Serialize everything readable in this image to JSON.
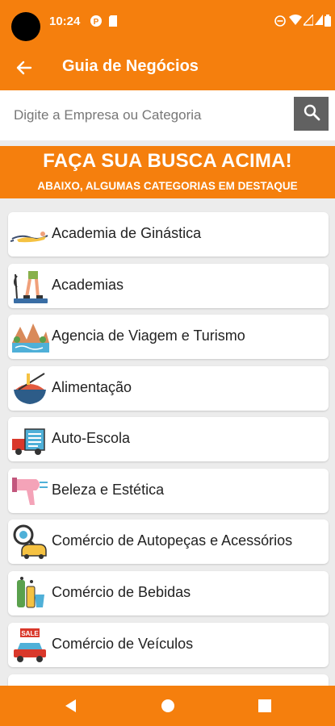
{
  "status_bar": {
    "time": "10:24",
    "icons": [
      "pinterest-icon",
      "sd-card-icon",
      "do-not-disturb-icon",
      "wifi-icon",
      "signal-icon",
      "signal-icon",
      "battery-icon"
    ]
  },
  "app_bar": {
    "back_icon": "arrow-left-icon",
    "title": "Guia de Negócios"
  },
  "search": {
    "placeholder": "Digite a Empresa ou Categoria",
    "value": "",
    "button_icon": "search-icon"
  },
  "banner": {
    "title": "FAÇA SUA BUSCA ACIMA!",
    "subtitle": "ABAIXO, ALGUMAS CATEGORIAS EM DESTAQUE"
  },
  "categories": [
    {
      "label": "Academia de Ginástica",
      "icon": "gymnast-icon"
    },
    {
      "label": "Academias",
      "icon": "exercise-machine-icon"
    },
    {
      "label": "Agencia de Viagem e Turismo",
      "icon": "landscape-icon"
    },
    {
      "label": "Alimentação",
      "icon": "food-bowl-icon"
    },
    {
      "label": "Auto-Escola",
      "icon": "driving-school-truck-icon"
    },
    {
      "label": "Beleza e Estética",
      "icon": "hair-dryer-icon"
    },
    {
      "label": "Comércio de Autopeças e Acessórios",
      "icon": "car-parts-icon"
    },
    {
      "label": "Comércio de Bebidas",
      "icon": "beverages-icon"
    },
    {
      "label": "Comércio de Veículos",
      "icon": "car-sale-icon"
    }
  ],
  "nav_bar": {
    "back": "triangle-back-icon",
    "home": "circle-home-icon",
    "recents": "square-recents-icon"
  },
  "colors": {
    "accent": "#f57f0d",
    "search_button": "#616161",
    "background": "#ececec"
  }
}
